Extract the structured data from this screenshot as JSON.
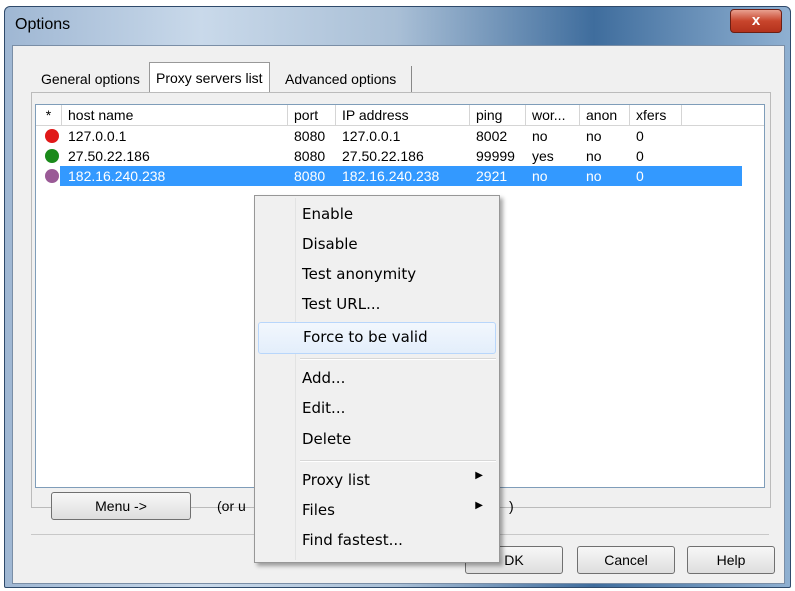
{
  "window": {
    "title": "Options",
    "close_label": "x"
  },
  "tabs": [
    {
      "label": "General options"
    },
    {
      "label": "Proxy servers list",
      "active": true
    },
    {
      "label": "Advanced options"
    }
  ],
  "list": {
    "columns": [
      "*",
      "host name",
      "port",
      "IP address",
      "ping",
      "wor...",
      "anon",
      "xfers"
    ],
    "rows": [
      {
        "status_color": "#e01818",
        "host": "127.0.0.1",
        "port": "8080",
        "ip": "127.0.0.1",
        "ping": "8002",
        "working": "no",
        "anon": "no",
        "xfers": "0"
      },
      {
        "status_color": "#1a8a1a",
        "host": "27.50.22.186",
        "port": "8080",
        "ip": "27.50.22.186",
        "ping": "99999",
        "working": "yes",
        "anon": "no",
        "xfers": "0"
      },
      {
        "status_color": "#9a5a96",
        "host": "182.16.240.238",
        "port": "8080",
        "ip": "182.16.240.238",
        "ping": "2921",
        "working": "no",
        "anon": "no",
        "xfers": "0",
        "selected": true
      }
    ]
  },
  "bottom": {
    "menu_button": "Menu ->",
    "hint_left": "(or u",
    "hint_right": ")"
  },
  "footer": {
    "ok": "OK",
    "ok_visible": "DK",
    "cancel": "Cancel",
    "help": "Help"
  },
  "context_menu": {
    "items": [
      {
        "label": "Enable"
      },
      {
        "label": "Disable"
      },
      {
        "label": "Test anonymity"
      },
      {
        "label": "Test URL..."
      },
      {
        "label": "Force to be valid",
        "highlighted": true
      },
      {
        "label": "Add..."
      },
      {
        "label": "Edit..."
      },
      {
        "label": "Delete"
      },
      {
        "label": "Proxy list",
        "submenu": true
      },
      {
        "label": "Files",
        "submenu": true
      },
      {
        "label": "Find fastest..."
      }
    ]
  }
}
